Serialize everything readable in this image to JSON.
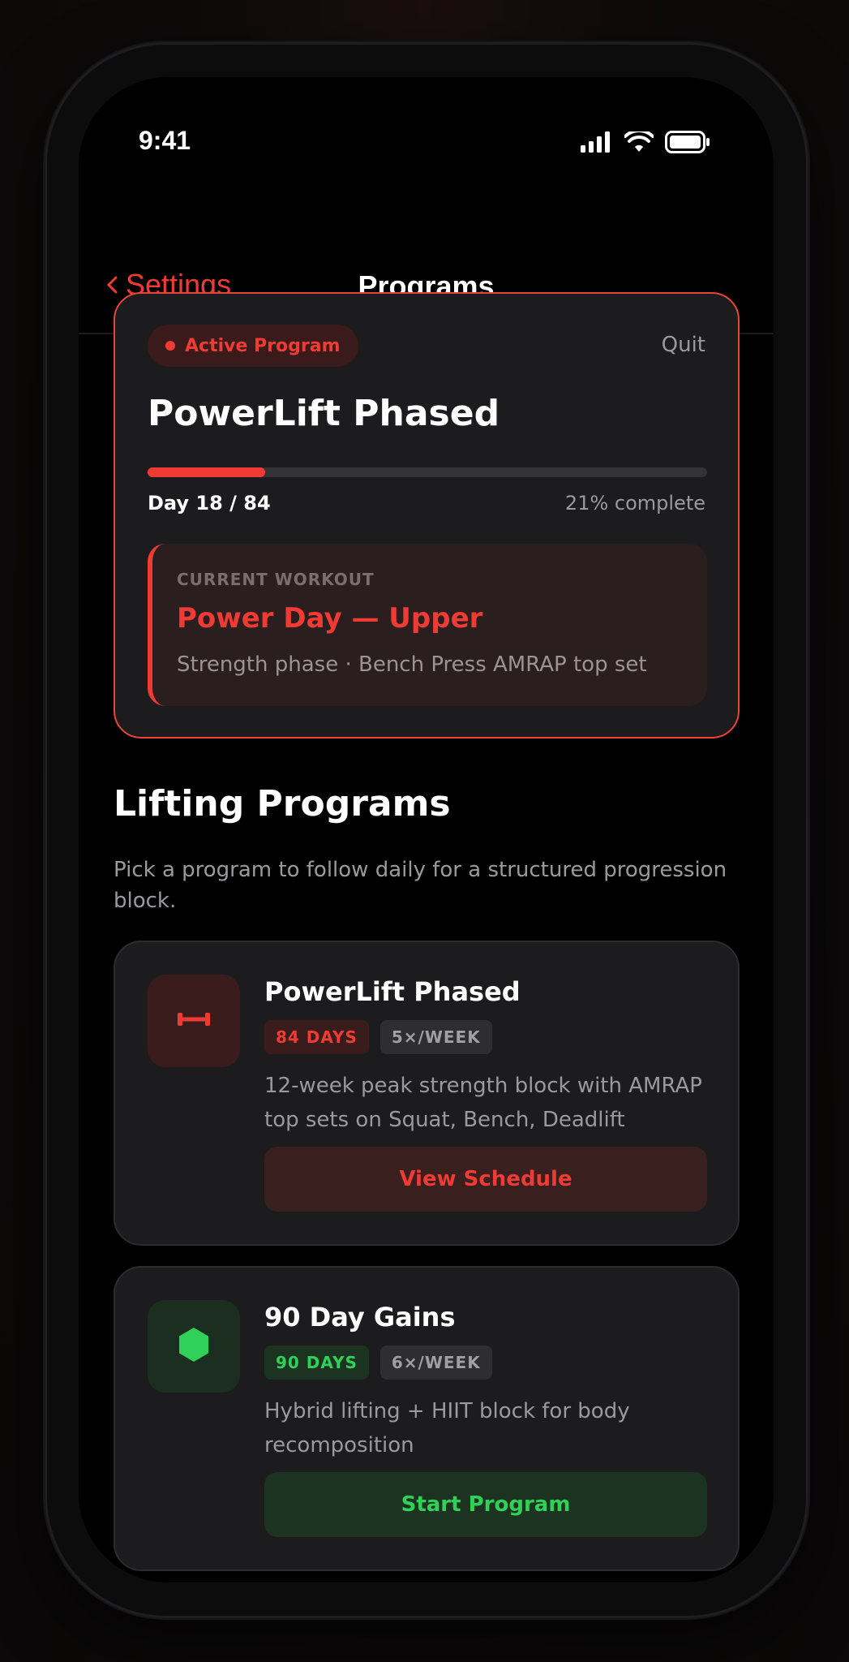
{
  "status_bar": {
    "time": "9:41"
  },
  "nav": {
    "back_label": "Settings",
    "title": "Programs"
  },
  "active_program": {
    "badge": "Active Program",
    "quit_label": "Quit",
    "name": "PowerLift Phased",
    "progress_fraction": 0.21,
    "day_text": "Day 18 / 84",
    "percent_text": "21% complete",
    "current_workout": {
      "label": "CURRENT WORKOUT",
      "name": "Power Day — Upper",
      "description": "Strength phase · Bench Press AMRAP top set"
    }
  },
  "section": {
    "title": "Lifting Programs",
    "subtitle": "Pick a program to follow daily for a structured progression block."
  },
  "programs": [
    {
      "icon": "dumbbell-icon",
      "title": "PowerLift Phased",
      "duration_tag": "84 DAYS",
      "frequency_tag": "5×/WEEK",
      "description": "12-week peak strength block with AMRAP top sets on Squat, Bench, Deadlift",
      "button_label": "View Schedule",
      "accent": "#ef3b34"
    },
    {
      "icon": "hexagon-icon",
      "title": "90 Day Gains",
      "duration_tag": "90 DAYS",
      "frequency_tag": "6×/WEEK",
      "description": "Hybrid lifting + HIIT block for body recomposition",
      "button_label": "Start Program",
      "accent": "#30d158"
    }
  ],
  "colors": {
    "accent_red": "#ef3b34",
    "accent_green": "#30d158",
    "card_bg": "#1c1c1e",
    "screen_bg": "#000000"
  }
}
